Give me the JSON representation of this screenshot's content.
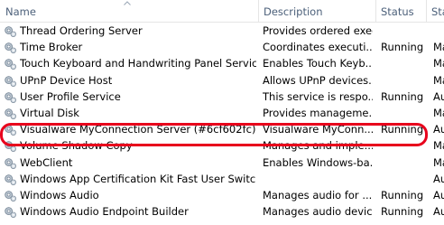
{
  "columns": {
    "name": "Name",
    "description": "Description",
    "status": "Status",
    "startup": "Sta"
  },
  "rows": [
    {
      "name": "Thread Ordering Server",
      "description": "Provides ordered exec...",
      "status": "",
      "startup": ""
    },
    {
      "name": "Time Broker",
      "description": "Coordinates executi...",
      "status": "Running",
      "startup": "Ma"
    },
    {
      "name": "Touch Keyboard and Handwriting Panel Service",
      "description": "Enables Touch Keyb...",
      "status": "",
      "startup": "Ma"
    },
    {
      "name": "UPnP Device Host",
      "description": "Allows UPnP devices...",
      "status": "",
      "startup": "Ma"
    },
    {
      "name": "User Profile Service",
      "description": "This service is respo...",
      "status": "Running",
      "startup": "Au"
    },
    {
      "name": "Virtual Disk",
      "description": "Provides manageme...",
      "status": "",
      "startup": "Ma"
    },
    {
      "name": "Visualware MyConnection Server (#6cf602fc)",
      "description": "Visualware MyConn...",
      "status": "Running",
      "startup": "Au"
    },
    {
      "name": "Volume Shadow Copy",
      "description": "Manages and imple...",
      "status": "",
      "startup": "Ma"
    },
    {
      "name": "WebClient",
      "description": "Enables Windows-ba...",
      "status": "",
      "startup": "Ma"
    },
    {
      "name": "Windows App Certification Kit Fast User Switchi...",
      "description": "",
      "status": "",
      "startup": "Au"
    },
    {
      "name": "Windows Audio",
      "description": "Manages audio for ...",
      "status": "Running",
      "startup": "Au"
    },
    {
      "name": "Windows Audio Endpoint Builder",
      "description": "Manages audio devic...",
      "status": "Running",
      "startup": "Au"
    }
  ],
  "highlighted_row": "Visualware MyConnection Server (#6cf602fc)",
  "highlight_color": "#e8001c",
  "header_text_color": "#4c607a",
  "row_icon": "gear-icon"
}
